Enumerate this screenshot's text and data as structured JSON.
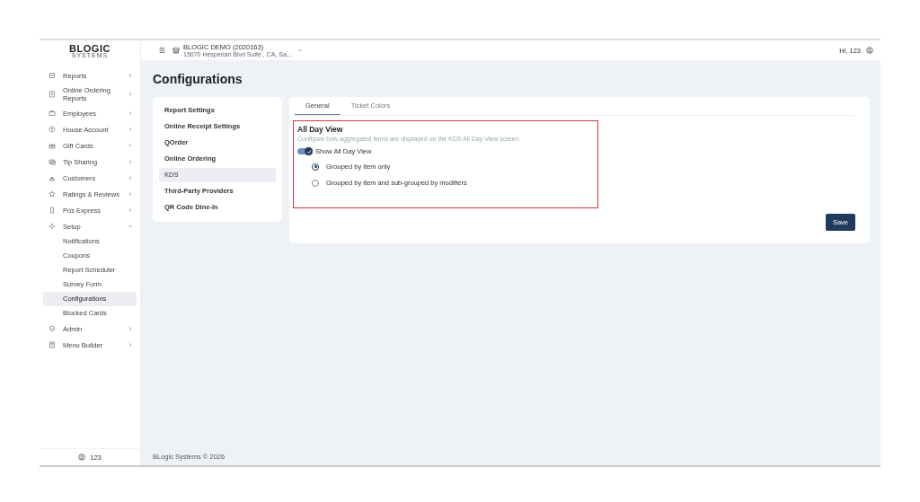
{
  "logo": {
    "name": "BLOGIC",
    "tagline": "SYSTEMS"
  },
  "sidebar": {
    "items": [
      {
        "label": "Reports",
        "expanded": false
      },
      {
        "label": "Online Ordering Reports",
        "expanded": false
      },
      {
        "label": "Employees",
        "expanded": false
      },
      {
        "label": "House Account",
        "expanded": false
      },
      {
        "label": "Gift Cards",
        "expanded": false
      },
      {
        "label": "Tip Sharing",
        "expanded": false
      },
      {
        "label": "Customers",
        "expanded": false
      },
      {
        "label": "Ratings & Reviews",
        "expanded": false
      },
      {
        "label": "Pos Express",
        "expanded": false
      },
      {
        "label": "Setup",
        "expanded": true,
        "children": [
          {
            "label": "Notifications",
            "selected": false
          },
          {
            "label": "Coupons",
            "selected": false
          },
          {
            "label": "Report Scheduler",
            "selected": false
          },
          {
            "label": "Survey Form",
            "selected": false
          },
          {
            "label": "Configurations",
            "selected": true
          },
          {
            "label": "Blocked Cards",
            "selected": false
          }
        ]
      },
      {
        "label": "Admin",
        "expanded": false
      },
      {
        "label": "Menu Builder",
        "expanded": false
      }
    ],
    "user": "123"
  },
  "header": {
    "store_name": "BLOGIC DEMO (2020163)",
    "store_address": "15070 Hesperian Blvd Suite , CA, Sa...",
    "greeting": "Hi, 123"
  },
  "page_title": "Configurations",
  "settings_menu": [
    {
      "label": "Report Settings",
      "selected": false
    },
    {
      "label": "Online Receipt Settings",
      "selected": false
    },
    {
      "label": "QOrder",
      "selected": false
    },
    {
      "label": "Online Ordering",
      "selected": false
    },
    {
      "label": "KDS",
      "selected": true
    },
    {
      "label": "Third-Party Providers",
      "selected": false
    },
    {
      "label": "QR Code Dine-In",
      "selected": false
    }
  ],
  "tabs": [
    {
      "label": "General",
      "selected": true
    },
    {
      "label": "Ticket Colors",
      "selected": false
    }
  ],
  "section": {
    "title": "All Day View",
    "description": "Configure how aggregated items are displayed on the KDS All Day View screen.",
    "toggle": {
      "label": "Show All Day View",
      "on": true
    },
    "options": [
      {
        "label": "Grouped by item only",
        "selected": true
      },
      {
        "label": "Grouped by item and sub-grouped by modifiers",
        "selected": false
      }
    ]
  },
  "save_button": "Save",
  "footer": "BLogic Systems © 2026"
}
